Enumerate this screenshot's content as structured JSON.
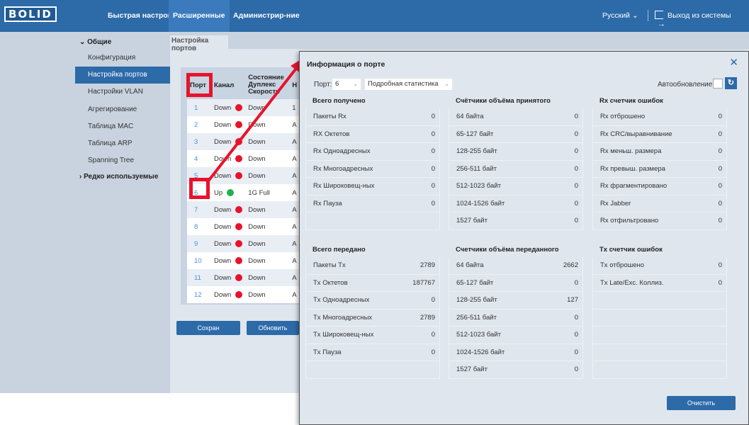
{
  "logo": "BOLID",
  "nav": {
    "quick": "Быстрая настройка",
    "advanced": "Расширенные",
    "admin": "Администрир-ние"
  },
  "lang": "Русский ⌄",
  "logout": "Выход из системы",
  "sidebar": {
    "group_general": "⌄ Общие",
    "items": [
      "Конфигурация",
      "Настройка портов",
      "Настройки VLAN",
      "Агрегирование",
      "Таблица MAC",
      "Таблица ARP",
      "Spanning Tree"
    ],
    "group_rare": "› Редко используемые"
  },
  "tab": "Настройка портов",
  "ports_table": {
    "headers": {
      "port": "Порт",
      "link": "Канал",
      "state": "Состояние Дуплекс Скорость",
      "h": "Н"
    },
    "rows": [
      {
        "port": "1",
        "link": "Down",
        "status": "red",
        "speed": "Down",
        "extra": "1"
      },
      {
        "port": "2",
        "link": "Down",
        "status": "red",
        "speed": "Down",
        "extra": "A"
      },
      {
        "port": "3",
        "link": "Down",
        "status": "red",
        "speed": "Down",
        "extra": "A"
      },
      {
        "port": "4",
        "link": "Down",
        "status": "red",
        "speed": "Down",
        "extra": "A"
      },
      {
        "port": "5",
        "link": "Down",
        "status": "red",
        "speed": "Down",
        "extra": "A"
      },
      {
        "port": "6",
        "link": "Up",
        "status": "green",
        "speed": "1G Full",
        "extra": "A"
      },
      {
        "port": "7",
        "link": "Down",
        "status": "red",
        "speed": "Down",
        "extra": "A"
      },
      {
        "port": "8",
        "link": "Down",
        "status": "red",
        "speed": "Down",
        "extra": "A"
      },
      {
        "port": "9",
        "link": "Down",
        "status": "red",
        "speed": "Down",
        "extra": "A"
      },
      {
        "port": "10",
        "link": "Down",
        "status": "red",
        "speed": "Down",
        "extra": "A"
      },
      {
        "port": "11",
        "link": "Down",
        "status": "red",
        "speed": "Down",
        "extra": "A"
      },
      {
        "port": "12",
        "link": "Down",
        "status": "red",
        "speed": "Down",
        "extra": "A"
      }
    ]
  },
  "buttons": {
    "save": "Сохран",
    "refresh": "Обновить",
    "clear": "Очистить"
  },
  "modal": {
    "title": "Информация о порте",
    "port_label": "Порт:",
    "port_value": "6",
    "mode_value": "Подробная статистика",
    "auto_refresh": "Автообновление:",
    "sections": [
      {
        "title": "Всего получено",
        "rows": [
          [
            "Пакеты Rx",
            "0"
          ],
          [
            "RX Октетов",
            "0"
          ],
          [
            "Rx Одноадресных",
            "0"
          ],
          [
            "Rx Многоадресных",
            "0"
          ],
          [
            "Rx Широковещ-ных",
            "0"
          ],
          [
            "Rx Пауза",
            "0"
          ],
          [
            "",
            ""
          ]
        ]
      },
      {
        "title": "Счётчики объёма принятого",
        "rows": [
          [
            "64 байта",
            "0"
          ],
          [
            "65-127 байт",
            "0"
          ],
          [
            "128-255 байт",
            "0"
          ],
          [
            "256-511 байт",
            "0"
          ],
          [
            "512-1023 байт",
            "0"
          ],
          [
            "1024-1526 байт",
            "0"
          ],
          [
            "1527 байт",
            "0"
          ]
        ]
      },
      {
        "title": "Rx счетчик ошибок",
        "rows": [
          [
            "Rx отброшено",
            "0"
          ],
          [
            "Rx CRC/выравнивание",
            "0"
          ],
          [
            "Rx меньш. размера",
            "0"
          ],
          [
            "Rx превыш. размера",
            "0"
          ],
          [
            "Rx фрагментировано",
            "0"
          ],
          [
            "Rx Jabber",
            "0"
          ],
          [
            "Rx отфильтровано",
            "0"
          ]
        ]
      },
      {
        "title": "Всего передано",
        "rows": [
          [
            "Пакеты Tx",
            "2789"
          ],
          [
            "Tx Октетов",
            "187767"
          ],
          [
            "Tx Одноадресных",
            "0"
          ],
          [
            "Tx Многоадресных",
            "2789"
          ],
          [
            "Tx Широковещ-ных",
            "0"
          ],
          [
            "Tx Пауза",
            "0"
          ],
          [
            "",
            ""
          ]
        ]
      },
      {
        "title": "Счетчики объёма переданного",
        "rows": [
          [
            "64 байта",
            "2662"
          ],
          [
            "65-127 байт",
            "0"
          ],
          [
            "128-255 байт",
            "127"
          ],
          [
            "256-511 байт",
            "0"
          ],
          [
            "512-1023 байт",
            "0"
          ],
          [
            "1024-1526 байт",
            "0"
          ],
          [
            "1527 байт",
            "0"
          ]
        ]
      },
      {
        "title": "Tx счетчик ошибок",
        "rows": [
          [
            "Tx отброшено",
            "0"
          ],
          [
            "Tx Late/Exc. Коллиз.",
            "0"
          ],
          [
            "",
            ""
          ],
          [
            "",
            ""
          ],
          [
            "",
            ""
          ],
          [
            "",
            ""
          ],
          [
            "",
            ""
          ]
        ]
      }
    ]
  },
  "colors": {
    "brand": "#2c6aa8",
    "highlight": "#e8132a",
    "up": "#22b14c",
    "down": "#e8132a"
  }
}
